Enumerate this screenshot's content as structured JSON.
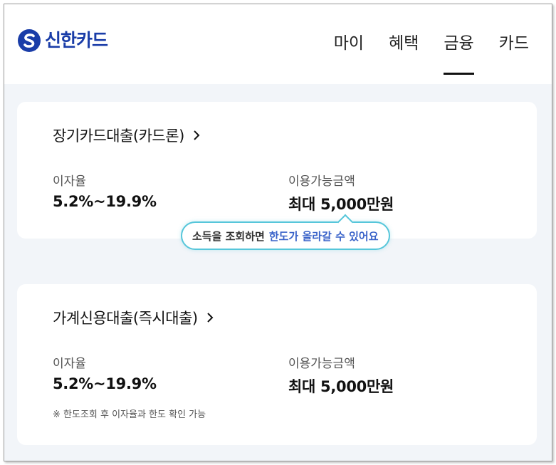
{
  "header": {
    "brand": "신한카드",
    "nav": [
      {
        "label": "마이",
        "active": false
      },
      {
        "label": "혜택",
        "active": false
      },
      {
        "label": "금융",
        "active": true
      },
      {
        "label": "카드",
        "active": false
      }
    ]
  },
  "products": [
    {
      "title": "장기카드대출(카드론)",
      "rate_label": "이자율",
      "rate_value": "5.2%~19.9%",
      "limit_label": "이용가능금액",
      "limit_value": "최대 5,000만원"
    },
    {
      "title": "가계신용대출(즉시대출)",
      "rate_label": "이자율",
      "rate_value": "5.2%~19.9%",
      "limit_label": "이용가능금액",
      "limit_value": "최대 5,000만원",
      "note": "※ 한도조회 후 이자율과 한도 확인 가능"
    }
  ],
  "tooltip": {
    "text": "소득을 조회하면",
    "highlight": "한도가 올라갈 수 있어요"
  },
  "colors": {
    "brand": "#1a3da8",
    "accent": "#3a63c9",
    "tooltip_border": "#56c6da",
    "background": "#f2f5f9"
  }
}
